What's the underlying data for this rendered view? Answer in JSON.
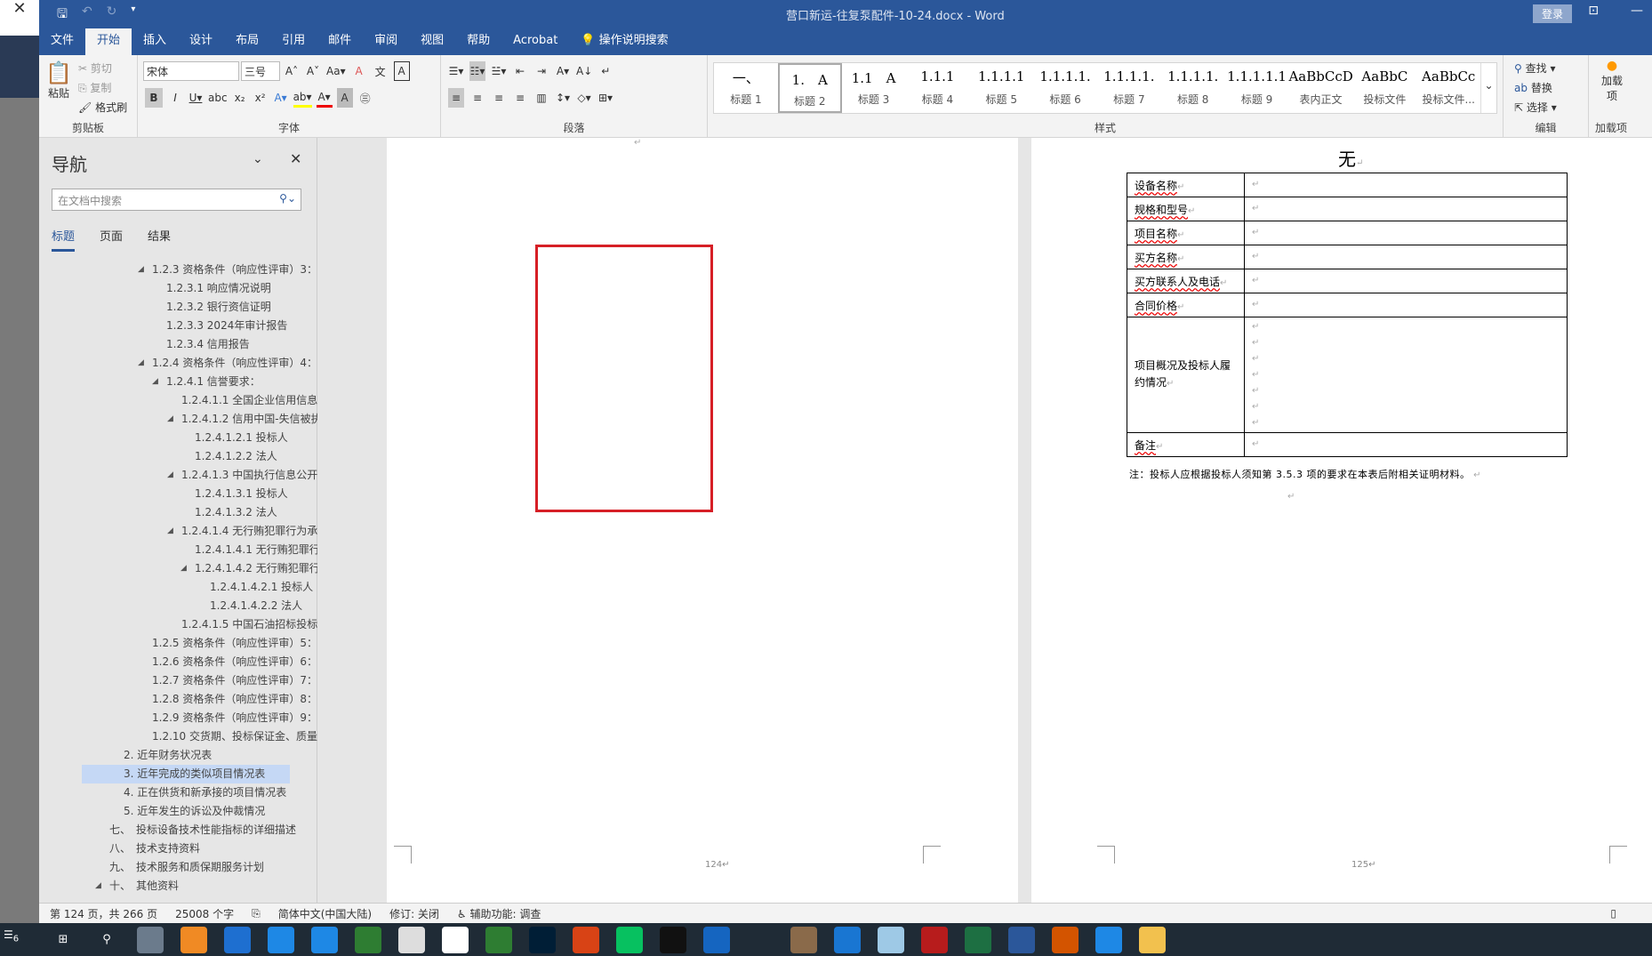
{
  "window": {
    "title": "营口新运-往复泵配件-10-24.docx  -  Word",
    "login": "登录"
  },
  "tabs": [
    "文件",
    "开始",
    "插入",
    "设计",
    "布局",
    "引用",
    "邮件",
    "审阅",
    "视图",
    "帮助",
    "Acrobat",
    "操作说明搜索"
  ],
  "ribbon": {
    "clipboard": {
      "label": "剪贴板",
      "paste": "粘贴",
      "cut": "剪切",
      "copy": "复制",
      "format_painter": "格式刷"
    },
    "font": {
      "label": "字体",
      "font_name": "宋体",
      "font_size": "三号"
    },
    "paragraph": {
      "label": "段落"
    },
    "styles": {
      "label": "样式",
      "items": [
        {
          "preview": "一、",
          "name": "标题 1"
        },
        {
          "preview": "1.　A",
          "name": "标题 2"
        },
        {
          "preview": "1.1　A",
          "name": "标题 3"
        },
        {
          "preview": "1.1.1",
          "name": "标题 4"
        },
        {
          "preview": "1.1.1.1",
          "name": "标题 5"
        },
        {
          "preview": "1.1.1.1.",
          "name": "标题 6"
        },
        {
          "preview": "1.1.1.1.",
          "name": "标题 7"
        },
        {
          "preview": "1.1.1.1.",
          "name": "标题 8"
        },
        {
          "preview": "1.1.1.1.1",
          "name": "标题 9"
        },
        {
          "preview": "AaBbCcDdI",
          "name": "表内正文"
        },
        {
          "preview": "AaBbC",
          "name": "投标文件"
        },
        {
          "preview": "AaBbCc",
          "name": "投标文件..."
        }
      ]
    },
    "editing": {
      "label": "编辑",
      "find": "查找",
      "replace": "替换",
      "select": "选择"
    },
    "addins": {
      "label": "加载项",
      "button": "加载项"
    }
  },
  "nav": {
    "title": "导航",
    "search_placeholder": "在文档中搜索",
    "tabs": [
      "标题",
      "页面",
      "结果"
    ],
    "items": [
      {
        "text": "1.2.3 资格条件（响应性评审）3：",
        "level": 3,
        "expanded": true
      },
      {
        "text": "1.2.3.1 响应情况说明",
        "level": 4
      },
      {
        "text": "1.2.3.2 银行资信证明",
        "level": 4
      },
      {
        "text": "1.2.3.3 2024年审计报告",
        "level": 4
      },
      {
        "text": "1.2.3.4 信用报告",
        "level": 4
      },
      {
        "text": "1.2.4 资格条件（响应性评审）4：",
        "level": 3,
        "expanded": true
      },
      {
        "text": "1.2.4.1 信誉要求：",
        "level": 4,
        "expanded": true
      },
      {
        "text": "1.2.4.1.1 全国企业信用信息...",
        "level": 5
      },
      {
        "text": "1.2.4.1.2 信用中国-失信被执...",
        "level": 5,
        "expanded": true
      },
      {
        "text": "1.2.4.1.2.1 投标人",
        "level": 6
      },
      {
        "text": "1.2.4.1.2.2 法人",
        "level": 6
      },
      {
        "text": "1.2.4.1.3 中国执行信息公开...",
        "level": 5,
        "expanded": true
      },
      {
        "text": "1.2.4.1.3.1 投标人",
        "level": 6
      },
      {
        "text": "1.2.4.1.3.2 法人",
        "level": 6
      },
      {
        "text": "1.2.4.1.4 无行贿犯罪行为承诺",
        "level": 5,
        "expanded": true
      },
      {
        "text": "1.2.4.1.4.1 无行贿犯罪行为",
        "level": 6
      },
      {
        "text": "1.2.4.1.4.2 无行贿犯罪行...",
        "level": 6,
        "expanded": true
      },
      {
        "text": "1.2.4.1.4.2.1 投标人",
        "level": 7
      },
      {
        "text": "1.2.4.1.4.2.2 法人",
        "level": 7
      },
      {
        "text": "1.2.4.1.5 中国石油招标投标...",
        "level": 5
      },
      {
        "text": "1.2.5 资格条件（响应性评审）5：",
        "level": 3
      },
      {
        "text": "1.2.6 资格条件（响应性评审）6：",
        "level": 3
      },
      {
        "text": "1.2.7 资格条件（响应性评审）7：",
        "level": 3
      },
      {
        "text": "1.2.8 资格条件（响应性评审）8：",
        "level": 3
      },
      {
        "text": "1.2.9 资格条件（响应性评审）9：",
        "level": 3
      },
      {
        "text": "1.2.10 交货期、投标保证金、质量...",
        "level": 3
      },
      {
        "text": "2. 近年财务状况表",
        "level": 2
      },
      {
        "text": "3. 近年完成的类似项目情况表",
        "level": 2,
        "selected": true
      },
      {
        "text": "4. 正在供货和新承接的项目情况表",
        "level": 2
      },
      {
        "text": "5. 近年发生的诉讼及仲裁情况",
        "level": 2
      },
      {
        "text": "七、　投标设备技术性能指标的详细描述",
        "level": 1
      },
      {
        "text": "八、　技术支持资料",
        "level": 1
      },
      {
        "text": "九、　技术服务和质保期服务计划",
        "level": 1
      },
      {
        "text": "十、　其他资料",
        "level": 1,
        "expanded": true
      }
    ]
  },
  "document": {
    "page_left": {
      "number": "124↵",
      "highlight_color": "#d61f26"
    },
    "page_right": {
      "heading": "无",
      "number": "125↵",
      "table": [
        {
          "label": "设备名称",
          "lines": 1
        },
        {
          "label": "规格和型号",
          "lines": 1
        },
        {
          "label": "项目名称",
          "lines": 1
        },
        {
          "label": "买方名称",
          "lines": 1
        },
        {
          "label": "买方联系人及电话",
          "lines": 1
        },
        {
          "label": "合同价格",
          "lines": 1
        },
        {
          "label": "项目概况及投标人履约情况",
          "lines": 7,
          "plain": true
        },
        {
          "label": "备注",
          "lines": 1
        }
      ],
      "note": "注：投标人应根据投标人须知第 3.5.3 项的要求在本表后附相关证明材料。"
    }
  },
  "status": {
    "page": "第 124 页，共 266 页",
    "words": "25008 个字",
    "language": "简体中文(中国大陆)",
    "track": "修订: 关闭",
    "accessibility": "辅助功能: 调查"
  },
  "taskbar": {
    "badge": "6",
    "apps": [
      "windows-start",
      "search",
      "calculator",
      "app-orange",
      "app-dots",
      "app-blue",
      "app-qq-browser",
      "app-green",
      "app-file",
      "app-doc",
      "app-pen",
      "photoshop",
      "app-flower",
      "wechat",
      "qq",
      "app-ie",
      "app-ai",
      "app-active",
      "edge",
      "app-glass",
      "acrobat",
      "excel",
      "word",
      "app-wps",
      "app-arrow",
      "file-explorer"
    ]
  }
}
